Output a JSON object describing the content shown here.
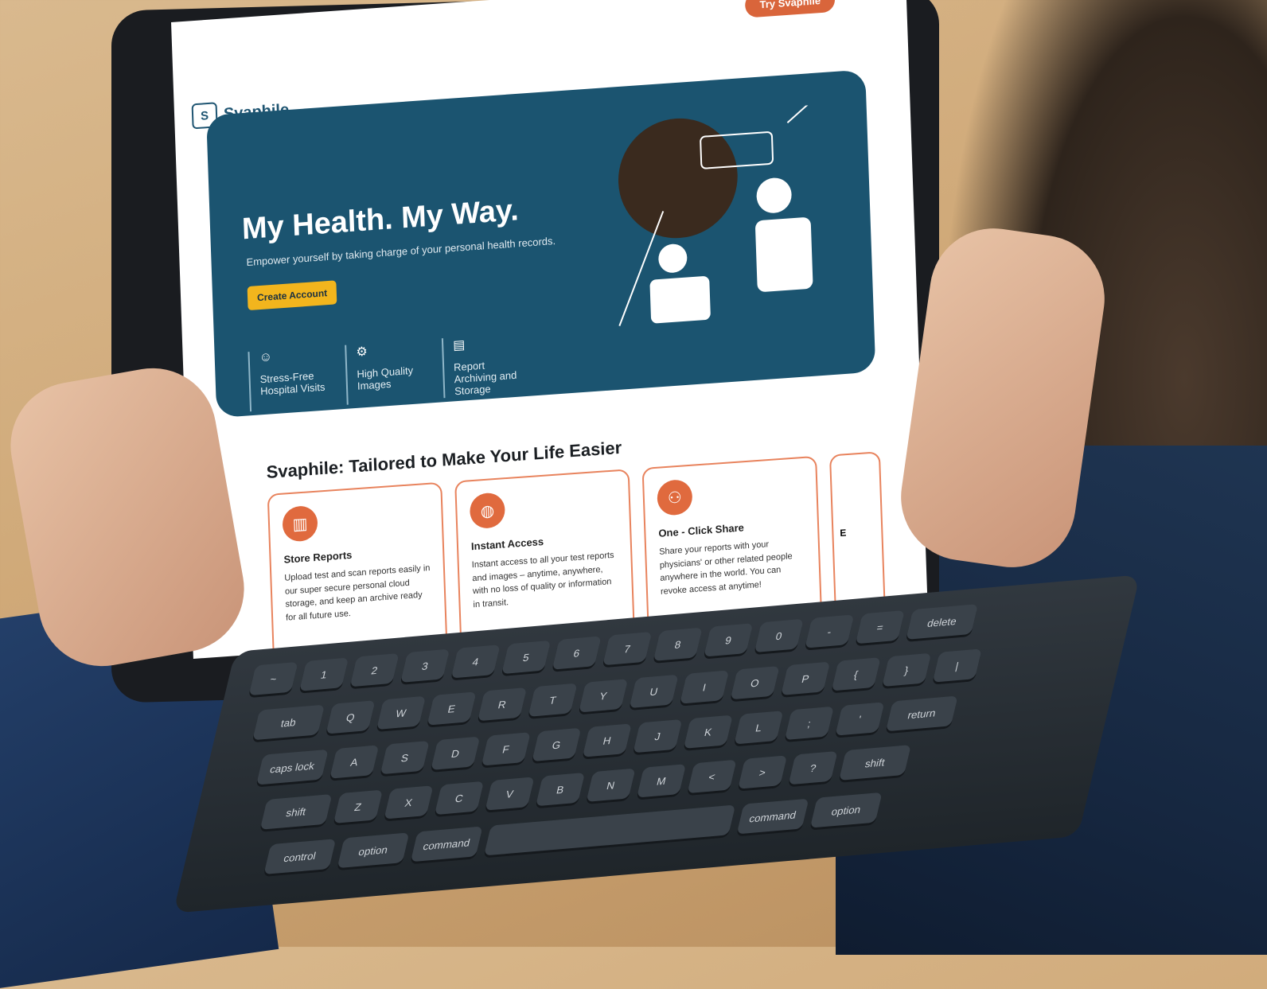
{
  "page": {
    "try_button": "Try Svaphile",
    "logo_text": "Svaphile",
    "logo_mark": "S"
  },
  "hero": {
    "title": "My Health. My Way.",
    "subtitle": "Empower yourself by taking charge of your personal health records.",
    "cta": "Create Account",
    "features": [
      {
        "label": "Stress-Free Hospital Visits",
        "icon": "person-relax-icon"
      },
      {
        "label": "High Quality Images",
        "icon": "gears-icon"
      },
      {
        "label": "Report Archiving and Storage",
        "icon": "archive-box-icon"
      }
    ]
  },
  "section": {
    "title": "Svaphile: Tailored to Make Your Life Easier",
    "cards": [
      {
        "title": "Store Reports",
        "desc": "Upload test and scan reports easily in our super secure personal cloud storage, and keep an archive ready for all future use.",
        "icon": "folders-icon"
      },
      {
        "title": "Instant Access",
        "desc": "Instant access to all your test reports and images – anytime, anywhere, with no loss of quality or information in transit.",
        "icon": "globe-hand-icon"
      },
      {
        "title": "One - Click Share",
        "desc": "Share your reports with your physicians' or other related people anywhere in the world. You can revoke access at anytime!",
        "icon": "share-people-icon"
      }
    ],
    "partial_card_letter": "E"
  },
  "keyboard": {
    "rows": [
      [
        "~",
        "1",
        "2",
        "3",
        "4",
        "5",
        "6",
        "7",
        "8",
        "9",
        "0",
        "-",
        "=",
        "delete"
      ],
      [
        "tab",
        "Q",
        "W",
        "E",
        "R",
        "T",
        "Y",
        "U",
        "I",
        "O",
        "P",
        "{",
        "}",
        "|"
      ],
      [
        "caps lock",
        "A",
        "S",
        "D",
        "F",
        "G",
        "H",
        "J",
        "K",
        "L",
        ";",
        "'",
        "return"
      ],
      [
        "shift",
        "Z",
        "X",
        "C",
        "V",
        "B",
        "N",
        "M",
        "<",
        ">",
        "?",
        "shift"
      ],
      [
        "control",
        "option",
        "command",
        "",
        "command",
        "option"
      ]
    ]
  },
  "colors": {
    "hero_bg": "#1b5470",
    "accent_orange": "#d9653b",
    "cta_yellow": "#f2b51d"
  }
}
